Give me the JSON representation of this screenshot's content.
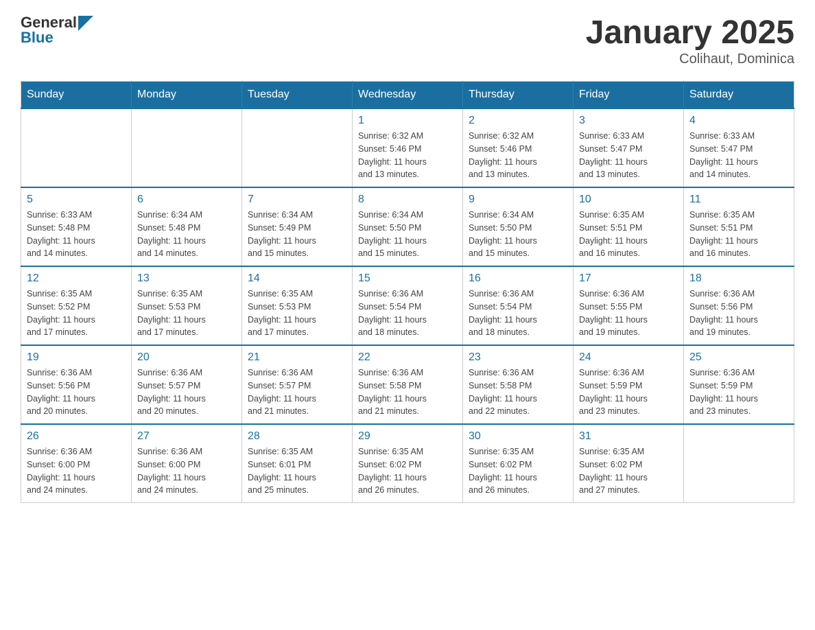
{
  "header": {
    "logo": {
      "general": "General",
      "blue": "Blue"
    },
    "title": "January 2025",
    "subtitle": "Colihaut, Dominica"
  },
  "days_of_week": [
    "Sunday",
    "Monday",
    "Tuesday",
    "Wednesday",
    "Thursday",
    "Friday",
    "Saturday"
  ],
  "weeks": [
    {
      "days": [
        {
          "number": "",
          "info": ""
        },
        {
          "number": "",
          "info": ""
        },
        {
          "number": "",
          "info": ""
        },
        {
          "number": "1",
          "info": "Sunrise: 6:32 AM\nSunset: 5:46 PM\nDaylight: 11 hours\nand 13 minutes."
        },
        {
          "number": "2",
          "info": "Sunrise: 6:32 AM\nSunset: 5:46 PM\nDaylight: 11 hours\nand 13 minutes."
        },
        {
          "number": "3",
          "info": "Sunrise: 6:33 AM\nSunset: 5:47 PM\nDaylight: 11 hours\nand 13 minutes."
        },
        {
          "number": "4",
          "info": "Sunrise: 6:33 AM\nSunset: 5:47 PM\nDaylight: 11 hours\nand 14 minutes."
        }
      ]
    },
    {
      "days": [
        {
          "number": "5",
          "info": "Sunrise: 6:33 AM\nSunset: 5:48 PM\nDaylight: 11 hours\nand 14 minutes."
        },
        {
          "number": "6",
          "info": "Sunrise: 6:34 AM\nSunset: 5:48 PM\nDaylight: 11 hours\nand 14 minutes."
        },
        {
          "number": "7",
          "info": "Sunrise: 6:34 AM\nSunset: 5:49 PM\nDaylight: 11 hours\nand 15 minutes."
        },
        {
          "number": "8",
          "info": "Sunrise: 6:34 AM\nSunset: 5:50 PM\nDaylight: 11 hours\nand 15 minutes."
        },
        {
          "number": "9",
          "info": "Sunrise: 6:34 AM\nSunset: 5:50 PM\nDaylight: 11 hours\nand 15 minutes."
        },
        {
          "number": "10",
          "info": "Sunrise: 6:35 AM\nSunset: 5:51 PM\nDaylight: 11 hours\nand 16 minutes."
        },
        {
          "number": "11",
          "info": "Sunrise: 6:35 AM\nSunset: 5:51 PM\nDaylight: 11 hours\nand 16 minutes."
        }
      ]
    },
    {
      "days": [
        {
          "number": "12",
          "info": "Sunrise: 6:35 AM\nSunset: 5:52 PM\nDaylight: 11 hours\nand 17 minutes."
        },
        {
          "number": "13",
          "info": "Sunrise: 6:35 AM\nSunset: 5:53 PM\nDaylight: 11 hours\nand 17 minutes."
        },
        {
          "number": "14",
          "info": "Sunrise: 6:35 AM\nSunset: 5:53 PM\nDaylight: 11 hours\nand 17 minutes."
        },
        {
          "number": "15",
          "info": "Sunrise: 6:36 AM\nSunset: 5:54 PM\nDaylight: 11 hours\nand 18 minutes."
        },
        {
          "number": "16",
          "info": "Sunrise: 6:36 AM\nSunset: 5:54 PM\nDaylight: 11 hours\nand 18 minutes."
        },
        {
          "number": "17",
          "info": "Sunrise: 6:36 AM\nSunset: 5:55 PM\nDaylight: 11 hours\nand 19 minutes."
        },
        {
          "number": "18",
          "info": "Sunrise: 6:36 AM\nSunset: 5:56 PM\nDaylight: 11 hours\nand 19 minutes."
        }
      ]
    },
    {
      "days": [
        {
          "number": "19",
          "info": "Sunrise: 6:36 AM\nSunset: 5:56 PM\nDaylight: 11 hours\nand 20 minutes."
        },
        {
          "number": "20",
          "info": "Sunrise: 6:36 AM\nSunset: 5:57 PM\nDaylight: 11 hours\nand 20 minutes."
        },
        {
          "number": "21",
          "info": "Sunrise: 6:36 AM\nSunset: 5:57 PM\nDaylight: 11 hours\nand 21 minutes."
        },
        {
          "number": "22",
          "info": "Sunrise: 6:36 AM\nSunset: 5:58 PM\nDaylight: 11 hours\nand 21 minutes."
        },
        {
          "number": "23",
          "info": "Sunrise: 6:36 AM\nSunset: 5:58 PM\nDaylight: 11 hours\nand 22 minutes."
        },
        {
          "number": "24",
          "info": "Sunrise: 6:36 AM\nSunset: 5:59 PM\nDaylight: 11 hours\nand 23 minutes."
        },
        {
          "number": "25",
          "info": "Sunrise: 6:36 AM\nSunset: 5:59 PM\nDaylight: 11 hours\nand 23 minutes."
        }
      ]
    },
    {
      "days": [
        {
          "number": "26",
          "info": "Sunrise: 6:36 AM\nSunset: 6:00 PM\nDaylight: 11 hours\nand 24 minutes."
        },
        {
          "number": "27",
          "info": "Sunrise: 6:36 AM\nSunset: 6:00 PM\nDaylight: 11 hours\nand 24 minutes."
        },
        {
          "number": "28",
          "info": "Sunrise: 6:35 AM\nSunset: 6:01 PM\nDaylight: 11 hours\nand 25 minutes."
        },
        {
          "number": "29",
          "info": "Sunrise: 6:35 AM\nSunset: 6:02 PM\nDaylight: 11 hours\nand 26 minutes."
        },
        {
          "number": "30",
          "info": "Sunrise: 6:35 AM\nSunset: 6:02 PM\nDaylight: 11 hours\nand 26 minutes."
        },
        {
          "number": "31",
          "info": "Sunrise: 6:35 AM\nSunset: 6:02 PM\nDaylight: 11 hours\nand 27 minutes."
        },
        {
          "number": "",
          "info": ""
        }
      ]
    }
  ]
}
